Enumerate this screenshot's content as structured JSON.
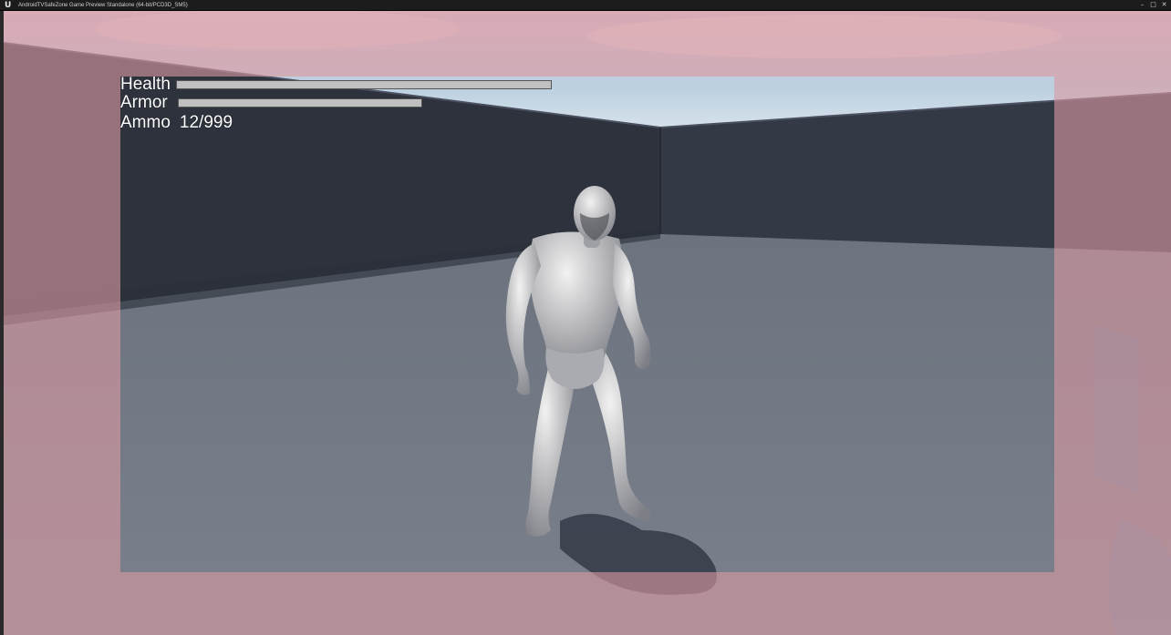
{
  "window": {
    "title": "AndroidTVSafeZone Game Preview Standalone (64-bit/PCD3D_SM5)",
    "logo_glyph": "U",
    "minimize_glyph": "–",
    "restore_glyph": "□",
    "close_glyph": "✕"
  },
  "hud": {
    "health_label": "Health",
    "health_value": 1.0,
    "armor_label": "Armor",
    "armor_value": 0.65,
    "ammo_label": "Ammo",
    "ammo_value": "12/999"
  },
  "colors": {
    "safezone_tint": "#d99aa2",
    "wall": "#2e3340",
    "floor": "#777e89",
    "sky": "#b9c9d8",
    "hud_bar": "#c0c0c0"
  }
}
